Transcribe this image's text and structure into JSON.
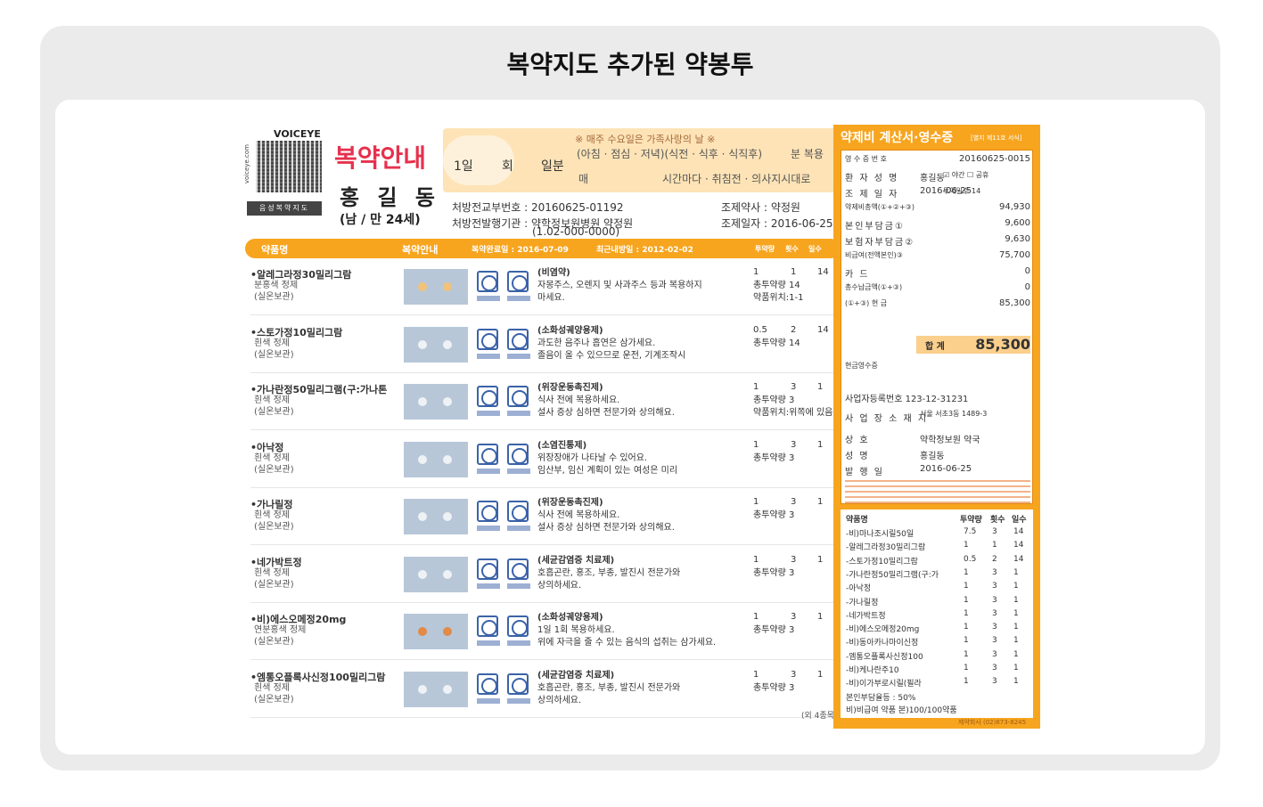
{
  "title": "복약지도 추가된 약봉투",
  "envelope": {
    "brand": "VOICEYE",
    "brand_url": "voiceye.com",
    "brand_tag": "음성복약지도",
    "heading": "복약안내",
    "patient_name": "홍 길 동",
    "patient_info": "(남 / 만 24세)",
    "dose": {
      "per_day": "1일",
      "times": "회",
      "amount": "일분",
      "note": "※ 매주 수요일은 가족사랑의 날 ※",
      "meal": "(아침 · 점심 · 저녁)(식전 · 식후 · 식직후)",
      "per_unit": "분 복용",
      "every": "매",
      "interval": "시간마다 · 취침전 · 의사지시대로"
    },
    "rx": {
      "number_label": "처방전교부번호 : 20160625-01192",
      "pharmacist": "조제약사 : 약정원",
      "hospital": "처방전발행기관 : 약학정보원병원 약정원",
      "phone": "(1.02-000-0000)",
      "date": "조제일자 : 2016-06-25"
    },
    "table_head": {
      "name": "약품명",
      "guide": "복약안내",
      "expiry": "복약완료일 : 2016-07-09",
      "last_visit": "최근내방일 : 2012-02-02",
      "dosage": "투약량",
      "times": "횟수",
      "days": "일수"
    },
    "drugs": [
      {
        "name": "•알레그라정30밀리그람",
        "form": "분홍색 정제",
        "storage": "(실온보관)",
        "category": "(비염약)",
        "l1": "자몽주스, 오렌지 및 사과주스 등과 복용하지",
        "l2": "마세요.",
        "dose": "1",
        "times": "1",
        "days": "14",
        "e1": "총투약량 14",
        "e2": "약품위치:1-1"
      },
      {
        "name": "•스토가정10밀리그람",
        "form": "흰색 정제",
        "storage": "(실온보관)",
        "category": "(소화성궤양용제)",
        "l1": "과도한 음주나 흡연은 삼가세요.",
        "l2": "졸음이 올 수 있으므로 운전, 기계조작시",
        "dose": "0.5",
        "times": "2",
        "days": "14",
        "e1": "총투약량 14",
        "e2": ""
      },
      {
        "name": "•가나란정50밀리그램(구:가나톤",
        "form": "흰색 정제",
        "storage": "(실온보관)",
        "category": "(위장운동촉진제)",
        "l1": "식사 전에 복용하세요.",
        "l2": "설사 증상 심하면 전문가와 상의해요.",
        "dose": "1",
        "times": "3",
        "days": "1",
        "e1": "총투약량 3",
        "e2": "약품위치:위쪽에 있음"
      },
      {
        "name": "•아낙정",
        "form": "흰색 정제",
        "storage": "(실온보관)",
        "category": "(소염진통제)",
        "l1": "위장장애가 나타날 수 있어요.",
        "l2": "임산부, 임신 계획이 있는 여성은 미리",
        "dose": "1",
        "times": "3",
        "days": "1",
        "e1": "총투약량 3",
        "e2": ""
      },
      {
        "name": "•가나릴정",
        "form": "흰색 정제",
        "storage": "(실온보관)",
        "category": "(위장운동촉진제)",
        "l1": "식사 전에 복용하세요.",
        "l2": "설사 증상 심하면 전문가와 상의해요.",
        "dose": "1",
        "times": "3",
        "days": "1",
        "e1": "총투약량 3",
        "e2": ""
      },
      {
        "name": "•네가박트정",
        "form": "흰색 정제",
        "storage": "(실온보관)",
        "category": "(세균감염증 치료제)",
        "l1": "호흡곤란, 홍조, 부종, 발진시 전문가와",
        "l2": "상의하세요.",
        "dose": "1",
        "times": "3",
        "days": "1",
        "e1": "총투약량 3",
        "e2": ""
      },
      {
        "name": "•비)에스오메정20mg",
        "form": "연분홍색 정제",
        "storage": "(실온보관)",
        "category": "(소화성궤양용제)",
        "l1": "1일 1회 복용하세요.",
        "l2": "위에 자극을 줄 수 있는 음식의 섭취는 삼가세요.",
        "dose": "1",
        "times": "3",
        "days": "1",
        "e1": "총투약량 3",
        "e2": ""
      },
      {
        "name": "•엠통오플록사신정100밀리그람",
        "form": "흰색 정제",
        "storage": "(실온보관)",
        "category": "(세균감염증 치료제)",
        "l1": "호흡곤란, 홍조, 부종, 발진시 전문가와",
        "l2": "상의하세요.",
        "dose": "1",
        "times": "3",
        "days": "1",
        "e1": "총투약량 3",
        "e2": ""
      }
    ],
    "more_note": "(외 4종목)"
  },
  "receipt": {
    "title": "약제비 계산서·영수증",
    "subtitle": "[별지 제11호 서식]",
    "rows": [
      {
        "k": "영 수 증 번 호",
        "v": "20160625-0015"
      },
      {
        "k": "환 자 성 명",
        "v": "홍길동",
        "m": "☑ 야간  ☐ 공휴"
      },
      {
        "k": "조 제 일 자",
        "v": "2016-06-25",
        "m": "투약일수 14"
      },
      {
        "k": "약제비총액(①+②+③)",
        "v": "94,930"
      },
      {
        "k": "본인부담금①",
        "v": "9,600"
      },
      {
        "k": "보험자부담금②",
        "v": "9,630"
      },
      {
        "k": "비급여(전액본인)③",
        "v": "75,700"
      },
      {
        "k": "카 드",
        "v": "0"
      },
      {
        "k": "총수납금액(①+③)",
        "v": "0"
      },
      {
        "k": "(①+③) 현 금",
        "v": "85,300"
      }
    ],
    "total_label": "합 계",
    "total_value": "85,300",
    "cash_receipt": "현금영수증",
    "biz_no": "사업자등록번호 123-12-31231",
    "address_label": "사 업 장 소 재 지",
    "address": "서울 서초3동 1489-3",
    "shop_label": "상 호",
    "shop": "약학정보원 약국",
    "owner_label": "성 명",
    "owner": "홍길동",
    "issue_label": "발 행 일",
    "issue_date": "2016-06-25",
    "list_head": {
      "name": "약품명",
      "dose": "투약량",
      "times": "횟수",
      "days": "일수"
    },
    "list": [
      {
        "n": "-비)마나조시릴50일",
        "d": "7.5",
        "t": "3",
        "y": "14"
      },
      {
        "n": "-알레그라정30밀리그람",
        "d": "1",
        "t": "1",
        "y": "14"
      },
      {
        "n": "-스토가정10밀리그람",
        "d": "0.5",
        "t": "2",
        "y": "14"
      },
      {
        "n": "-가나란정50밀리그램(구:가",
        "d": "1",
        "t": "3",
        "y": "1"
      },
      {
        "n": "-아낙정",
        "d": "1",
        "t": "3",
        "y": "1"
      },
      {
        "n": "-가나릴정",
        "d": "1",
        "t": "3",
        "y": "1"
      },
      {
        "n": "-네가박트정",
        "d": "1",
        "t": "3",
        "y": "1"
      },
      {
        "n": "-비)에스오메정20mg",
        "d": "1",
        "t": "3",
        "y": "1"
      },
      {
        "n": "-비)동아카나마이신정",
        "d": "1",
        "t": "3",
        "y": "1"
      },
      {
        "n": "-엠통오플록사신정100",
        "d": "1",
        "t": "3",
        "y": "1"
      },
      {
        "n": "-비)케나란주10",
        "d": "1",
        "t": "3",
        "y": "1"
      },
      {
        "n": "-비)이가부로시릴(필라",
        "d": "1",
        "t": "3",
        "y": "1"
      }
    ],
    "list_note1": "본인부담율등 : 50%",
    "list_note2": "비)비급여 약품 본)100/100약품",
    "foot": "제약회사 (02)873-8245"
  }
}
